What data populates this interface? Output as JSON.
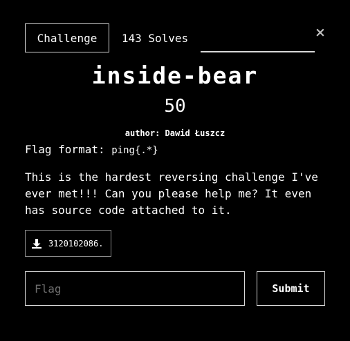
{
  "tabs": {
    "challenge_label": "Challenge",
    "solves_label": "143 Solves"
  },
  "close_icon": "close-icon",
  "challenge": {
    "name": "inside-bear",
    "points": "50",
    "author": "author: Dawid Łuszcz",
    "flag_format_label": "Flag format:",
    "flag_format_value": "ping{.*}",
    "description": "This is the hardest reversing challenge I've ever met!!! Can you please help me? It even has source code attached to it."
  },
  "attachment": {
    "icon": "download-icon",
    "file_name": "3120102086..."
  },
  "submission": {
    "flag_placeholder": "Flag",
    "flag_value": "",
    "submit_label": "Submit"
  },
  "colors": {
    "background": "#000000",
    "text": "#ffffff",
    "border": "#d9d9d9"
  }
}
